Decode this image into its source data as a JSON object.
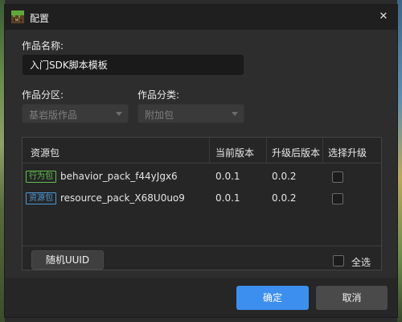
{
  "dialog": {
    "title": "配置",
    "close_glyph": "✕"
  },
  "form": {
    "name_label": "作品名称:",
    "name_value": "入门SDK脚本模板",
    "partition_label": "作品分区:",
    "partition_value": "基岩版作品",
    "category_label": "作品分类:",
    "category_value": "附加包"
  },
  "table": {
    "headers": {
      "pack": "资源包",
      "current_version": "当前版本",
      "upgraded_version": "升级后版本",
      "select_upgrade": "选择升级"
    },
    "rows": [
      {
        "tag": "行为包",
        "tag_type": "behavior",
        "name": "behavior_pack_f44yJgx6",
        "current": "0.0.1",
        "upgraded": "0.0.2",
        "checked": false
      },
      {
        "tag": "资源包",
        "tag_type": "resource",
        "name": "resource_pack_X68U0uo9",
        "current": "0.0.1",
        "upgraded": "0.0.2",
        "checked": false
      }
    ],
    "uuid_button": "随机UUID",
    "select_all_label": "全选"
  },
  "buttons": {
    "confirm": "确定",
    "cancel": "取消"
  },
  "colors": {
    "accent": "#3d8fef",
    "behavior_tag": "#5fbf4a",
    "resource_tag": "#4a9ad6"
  },
  "icons": {
    "title_logo": "minecraft-grass-block-icon",
    "close": "close-icon",
    "dropdown": "chevron-down-icon"
  }
}
